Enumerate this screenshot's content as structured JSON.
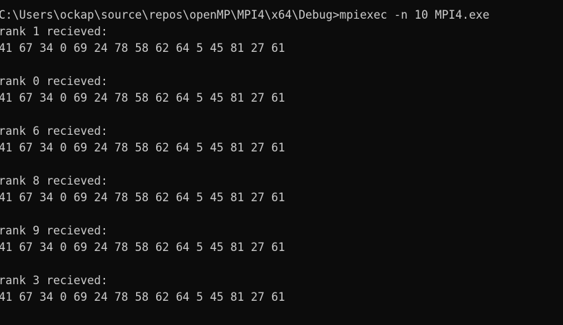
{
  "console": {
    "prompt": "C:\\Users\\ockap\\source\\repos\\openMP\\MPI4\\x64\\Debug>",
    "command": "mpiexec -n 10 MPI4.exe",
    "blocks": [
      {
        "header": "rank 1 recieved:",
        "values": "41 67 34 0 69 24 78 58 62 64 5 45 81 27 61"
      },
      {
        "header": "rank 0 recieved:",
        "values": "41 67 34 0 69 24 78 58 62 64 5 45 81 27 61"
      },
      {
        "header": "rank 6 recieved:",
        "values": "41 67 34 0 69 24 78 58 62 64 5 45 81 27 61"
      },
      {
        "header": "rank 8 recieved:",
        "values": "41 67 34 0 69 24 78 58 62 64 5 45 81 27 61"
      },
      {
        "header": "rank 9 recieved:",
        "values": "41 67 34 0 69 24 78 58 62 64 5 45 81 27 61"
      },
      {
        "header": "rank 3 recieved:",
        "values": "41 67 34 0 69 24 78 58 62 64 5 45 81 27 61"
      }
    ]
  }
}
